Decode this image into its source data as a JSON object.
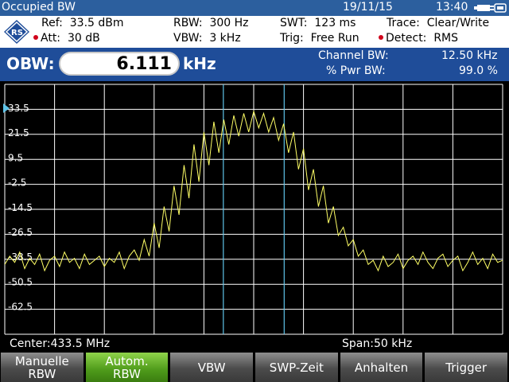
{
  "header": {
    "title": "Occupied BW",
    "date": "19/11/15",
    "time": "13:40"
  },
  "settings": {
    "ref_label": "Ref:",
    "ref_value": "33.5 dBm",
    "att_label": "Att:",
    "att_value": "30 dB",
    "rbw_label": "RBW:",
    "rbw_value": "300 Hz",
    "vbw_label": "VBW:",
    "vbw_value": "3 kHz",
    "swt_label": "SWT:",
    "swt_value": "123 ms",
    "trig_label": "Trig:",
    "trig_value": "Free Run",
    "trace_label": "Trace:",
    "trace_value": "Clear/Write",
    "detect_label": "Detect:",
    "detect_value": "RMS"
  },
  "obw": {
    "label": "OBW:",
    "value": "6.111",
    "unit": "kHz",
    "channel_bw_label": "Channel BW:",
    "channel_bw_value": "12.50 kHz",
    "pwr_bw_label": "% Pwr BW:",
    "pwr_bw_value": "99.0 %"
  },
  "plot": {
    "y_labels": [
      "33.5",
      "21.5",
      "9.5",
      "-2.5",
      "-14.5",
      "-26.5",
      "-38.5",
      "-50.5",
      "-62.5"
    ],
    "ref_level_dbm": 33.5,
    "db_per_div": 12,
    "trace_color": "#ffff66",
    "grid_color": "#ffffff",
    "marker_line_color": "#5fc3e8",
    "obw_lines_khz": [
      -3.05,
      3.06
    ],
    "trace_khz": [
      -25,
      -24.5,
      -24,
      -23.5,
      -23,
      -22.5,
      -22,
      -21.5,
      -21,
      -20.5,
      -20,
      -19.5,
      -19,
      -18.5,
      -18,
      -17.5,
      -17,
      -16.5,
      -16,
      -15.5,
      -15,
      -14.5,
      -14,
      -13.5,
      -13,
      -12.5,
      -12,
      -11.5,
      -11,
      -10.5,
      -10,
      -9.5,
      -9,
      -8.5,
      -8,
      -7.5,
      -7,
      -6.5,
      -6,
      -5.5,
      -5,
      -4.5,
      -4,
      -3.5,
      -3,
      -2.5,
      -2,
      -1.5,
      -1,
      -0.5,
      0,
      0.5,
      1,
      1.5,
      2,
      2.5,
      3,
      3.5,
      4,
      4.5,
      5,
      5.5,
      6,
      6.5,
      7,
      7.5,
      8,
      8.5,
      9,
      9.5,
      10,
      10.5,
      11,
      11.5,
      12,
      12.5,
      13,
      13.5,
      14,
      14.5,
      15,
      15.5,
      16,
      16.5,
      17,
      17.5,
      18,
      18.5,
      19,
      19.5,
      20,
      20.5,
      21,
      21.5,
      22,
      22.5,
      23,
      23.5,
      24,
      24.5,
      25
    ],
    "trace_dbm": [
      -42,
      -38,
      -41,
      -36,
      -44,
      -39,
      -42,
      -37,
      -45,
      -40,
      -38,
      -43,
      -36,
      -41,
      -39,
      -44,
      -37,
      -42,
      -40,
      -38,
      -43,
      -39,
      -41,
      -36,
      -44,
      -38,
      -35,
      -40,
      -30,
      -38,
      -22,
      -34,
      -14,
      -26,
      -4,
      -18,
      6,
      -10,
      16,
      -2,
      22,
      6,
      27,
      12,
      28,
      16,
      30,
      20,
      31,
      22,
      32,
      24,
      31,
      22,
      29,
      18,
      26,
      12,
      22,
      4,
      14,
      -6,
      4,
      -14,
      -4,
      -22,
      -14,
      -28,
      -24,
      -33,
      -30,
      -38,
      -35,
      -42,
      -40,
      -45,
      -38,
      -43,
      -41,
      -37,
      -44,
      -40,
      -38,
      -42,
      -36,
      -41,
      -44,
      -39,
      -37,
      -43,
      -40,
      -38,
      -45,
      -41,
      -36,
      -42,
      -39,
      -44,
      -37,
      -41,
      -40
    ],
    "center": "Center:433.5 MHz",
    "span": "Span:50 kHz"
  },
  "softkeys": [
    {
      "line1": "Manuelle",
      "line2": "RBW",
      "active": false
    },
    {
      "line1": "Autom.",
      "line2": "RBW",
      "active": true
    },
    {
      "line1": "VBW",
      "line2": "",
      "active": false
    },
    {
      "line1": "SWP-Zeit",
      "line2": "",
      "active": false
    },
    {
      "line1": "Anhalten",
      "line2": "",
      "active": false
    },
    {
      "line1": "Trigger",
      "line2": "",
      "active": false
    }
  ]
}
